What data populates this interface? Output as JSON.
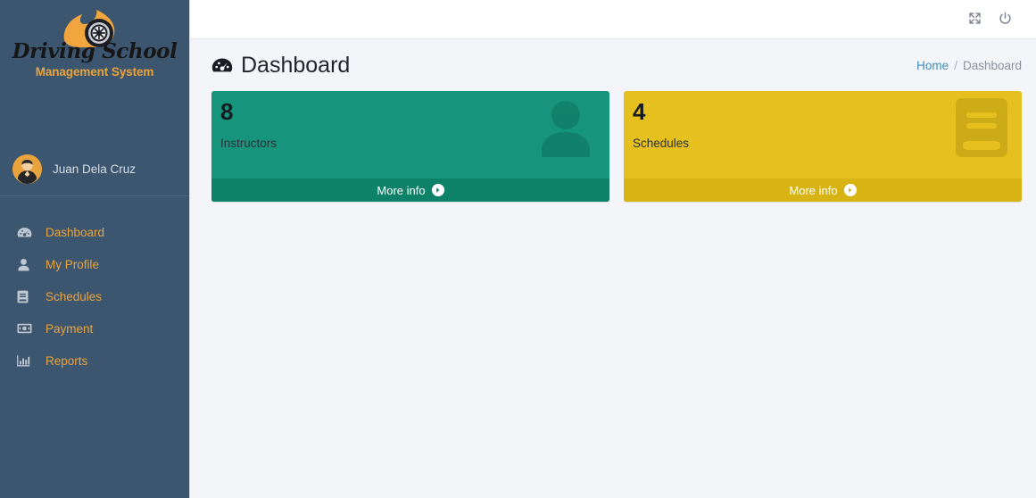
{
  "brand": {
    "script_text": "Driving School",
    "sub_text": "Management System",
    "logo_icon": "flame-wheel-logo-icon",
    "sub_color": "#e8a33d"
  },
  "sidebar": {
    "background_color": "#3c5670",
    "accent_color": "#e8a33d",
    "user": {
      "name": "Juan Dela Cruz",
      "avatar_icon": "user-avatar-icon",
      "avatar_color": "#e8a33d"
    },
    "items": [
      {
        "label": "Dashboard",
        "icon": "tachometer-icon"
      },
      {
        "label": "My Profile",
        "icon": "user-icon"
      },
      {
        "label": "Schedules",
        "icon": "book-icon"
      },
      {
        "label": "Payment",
        "icon": "money-bill-icon"
      },
      {
        "label": "Reports",
        "icon": "bar-chart-icon"
      }
    ]
  },
  "topbar": {
    "fullscreen_icon": "expand-arrows-icon",
    "power_icon": "power-off-icon"
  },
  "header": {
    "title": "Dashboard",
    "title_icon": "tachometer-icon",
    "breadcrumb": {
      "home_label": "Home",
      "separator": "/",
      "current_label": "Dashboard",
      "link_color": "#3c8dbc"
    }
  },
  "cards": [
    {
      "number": "8",
      "label": "Instructors",
      "icon": "user-icon",
      "footer_label": "More info",
      "footer_icon": "arrow-circle-right-icon",
      "bg_color": "#16957c",
      "footer_color": "#0e8268"
    },
    {
      "number": "4",
      "label": "Schedules",
      "icon": "book-icon",
      "footer_label": "More info",
      "footer_icon": "arrow-circle-right-icon",
      "bg_color": "#e5c01e",
      "footer_color": "#d7b313"
    }
  ]
}
